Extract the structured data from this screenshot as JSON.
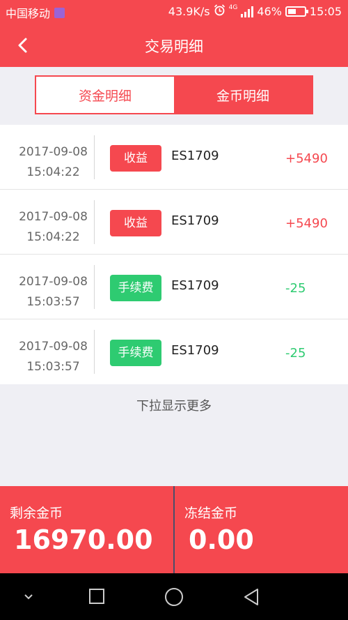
{
  "status_bar": {
    "carrier": "中国移动",
    "speed": "43.9K/s",
    "network": "4G",
    "battery": "46%",
    "time": "15:05"
  },
  "nav": {
    "title": "交易明细"
  },
  "segments": [
    {
      "label": "资金明细",
      "active": false
    },
    {
      "label": "金币明细",
      "active": true
    }
  ],
  "transactions": [
    {
      "date": "2017-09-08",
      "time": "15:04:22",
      "type": "收益",
      "type_color": "#f5484f",
      "code": "ES1709",
      "amount": "+5490"
    },
    {
      "date": "2017-09-08",
      "time": "15:04:22",
      "type": "收益",
      "type_color": "#f5484f",
      "code": "ES1709",
      "amount": "+5490"
    },
    {
      "date": "2017-09-08",
      "time": "15:03:57",
      "type": "手续费",
      "type_color": "#2ecb71",
      "code": "ES1709",
      "amount": "-25"
    },
    {
      "date": "2017-09-08",
      "time": "15:03:57",
      "type": "手续费",
      "type_color": "#2ecb71",
      "code": "ES1709",
      "amount": "-25"
    }
  ],
  "load_more": "下拉显示更多",
  "summary": {
    "remaining_label": "剩余金币",
    "remaining_value": "16970.00",
    "frozen_label": "冻结金币",
    "frozen_value": "0.00"
  },
  "colors": {
    "accent": "#f5484f",
    "positive_green": "#2ecb71"
  },
  "system_nav": {
    "icons": [
      "chevron-down-icon",
      "recents-square-icon",
      "home-circle-icon",
      "back-triangle-icon"
    ]
  }
}
